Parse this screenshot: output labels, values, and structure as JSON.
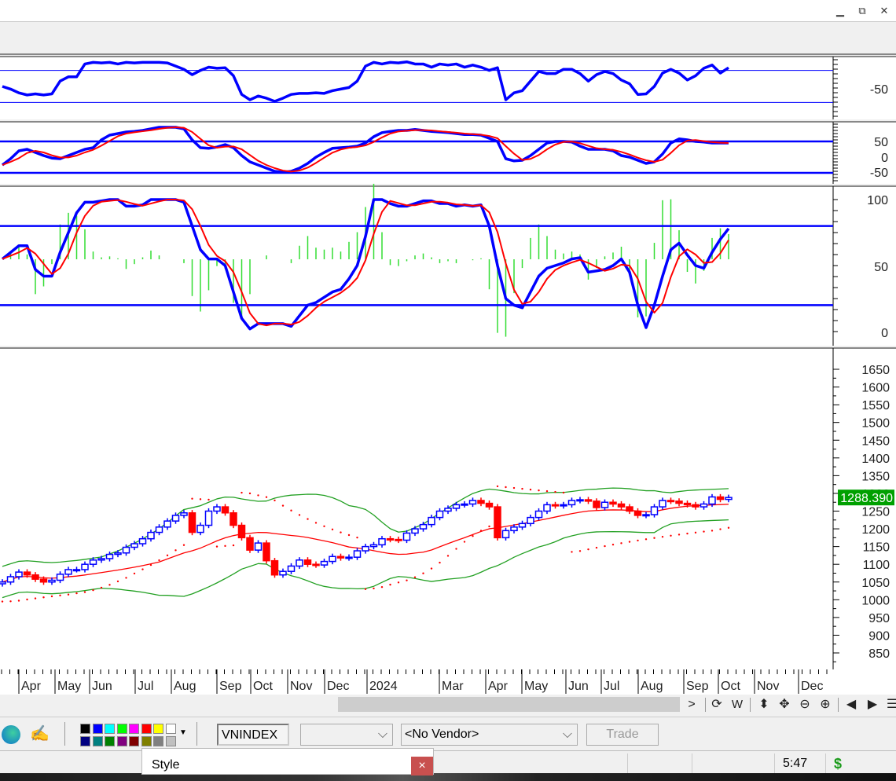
{
  "window": {
    "minimize_icon": "minimize-icon",
    "restore_icon": "restore-icon",
    "close_icon": "close-icon"
  },
  "chart_data": {
    "type": "candlestick",
    "symbol": "VNINDEX",
    "last_price_label": "1288.390",
    "x_tick_labels": [
      "Apr",
      "May",
      "Jun",
      "Jul",
      "Aug",
      "Sep",
      "Oct",
      "Nov",
      "Dec",
      "2024",
      "Mar",
      "Apr",
      "May",
      "Jun",
      "Jul",
      "Aug",
      "Sep",
      "Oct",
      "Nov",
      "Dec"
    ],
    "price_axis": {
      "ticks": [
        1650,
        1600,
        1550,
        1500,
        1450,
        1400,
        1350,
        1300,
        1250,
        1200,
        1150,
        1100,
        1050,
        1000,
        950,
        900,
        850
      ],
      "ylim": [
        830,
        1690
      ]
    },
    "close": [
      1050,
      1065,
      1078,
      1070,
      1058,
      1050,
      1055,
      1072,
      1085,
      1085,
      1100,
      1112,
      1116,
      1128,
      1132,
      1148,
      1158,
      1172,
      1190,
      1205,
      1222,
      1238,
      1245,
      1190,
      1210,
      1250,
      1262,
      1245,
      1210,
      1175,
      1140,
      1160,
      1110,
      1070,
      1080,
      1095,
      1112,
      1100,
      1098,
      1108,
      1122,
      1118,
      1120,
      1138,
      1150,
      1155,
      1172,
      1170,
      1168,
      1188,
      1200,
      1212,
      1232,
      1250,
      1258,
      1268,
      1270,
      1280,
      1272,
      1262,
      1175,
      1195,
      1205,
      1215,
      1232,
      1250,
      1268,
      1265,
      1268,
      1280,
      1282,
      1278,
      1260,
      1275,
      1270,
      1262,
      1250,
      1238,
      1240,
      1262,
      1280,
      1278,
      1272,
      1268,
      1262,
      1270,
      1290,
      1283,
      1288.39
    ],
    "williams_r": {
      "axis_label": "-50",
      "levels": [
        -20,
        -80
      ],
      "values": [
        -50,
        -55,
        -62,
        -66,
        -64,
        -66,
        -64,
        -40,
        -32,
        -32,
        -8,
        -5,
        -6,
        -5,
        -8,
        -5,
        -6,
        -5,
        -5,
        -5,
        -6,
        -12,
        -18,
        -28,
        -20,
        -14,
        -16,
        -15,
        -30,
        -65,
        -75,
        -68,
        -72,
        -78,
        -72,
        -65,
        -63,
        -63,
        -62,
        -63,
        -58,
        -55,
        -52,
        -40,
        -12,
        -5,
        -8,
        -5,
        -6,
        -4,
        -8,
        -8,
        -14,
        -8,
        -10,
        -8,
        -14,
        -10,
        -14,
        -20,
        -15,
        -75,
        -62,
        -58,
        -40,
        -22,
        -26,
        -26,
        -18,
        -18,
        -26,
        -40,
        -28,
        -22,
        -26,
        -38,
        -45,
        -65,
        -64,
        -50,
        -25,
        -18,
        -25,
        -38,
        -30,
        -16,
        -10,
        -25,
        -15
      ]
    },
    "cci": {
      "axis_labels": [
        "50",
        "0",
        "-50"
      ],
      "levels": [
        50,
        -50
      ],
      "values": [
        -25,
        -5,
        20,
        25,
        15,
        5,
        -3,
        -5,
        5,
        15,
        25,
        30,
        55,
        70,
        75,
        80,
        82,
        85,
        90,
        95,
        95,
        95,
        90,
        55,
        30,
        28,
        32,
        40,
        30,
        5,
        -15,
        -25,
        -35,
        -45,
        -48,
        -45,
        -35,
        -20,
        0,
        15,
        28,
        30,
        32,
        35,
        45,
        65,
        78,
        82,
        85,
        85,
        88,
        85,
        82,
        80,
        78,
        75,
        72,
        72,
        70,
        60,
        50,
        -5,
        -12,
        -10,
        5,
        25,
        45,
        50,
        50,
        48,
        35,
        25,
        25,
        25,
        20,
        5,
        0,
        -10,
        -20,
        -15,
        10,
        45,
        58,
        55,
        50,
        48,
        45,
        45,
        45
      ]
    },
    "stochastic": {
      "axis_labels": [
        "100",
        "50",
        "0"
      ],
      "levels": [
        80,
        20
      ],
      "k": [
        55,
        60,
        65,
        65,
        47,
        42,
        42,
        60,
        75,
        90,
        98,
        98,
        99,
        100,
        100,
        95,
        95,
        96,
        100,
        100,
        100,
        100,
        98,
        80,
        62,
        55,
        55,
        50,
        30,
        10,
        2,
        6,
        6,
        6,
        6,
        4,
        12,
        20,
        22,
        26,
        30,
        32,
        40,
        50,
        72,
        100,
        100,
        97,
        95,
        95,
        97,
        99,
        99,
        97,
        97,
        95,
        96,
        95,
        96,
        80,
        50,
        25,
        20,
        18,
        30,
        42,
        48,
        50,
        52,
        55,
        56,
        45,
        46,
        47,
        50,
        55,
        45,
        20,
        3,
        20,
        42,
        62,
        67,
        58,
        50,
        48,
        60,
        70,
        78
      ]
    },
    "colors": {
      "up": "#0000ff",
      "down": "#ff0000",
      "bands": "#22a022",
      "mid": "#ff0000",
      "signal": "#ff0000",
      "histogram": "#33dd33",
      "price_label_bg": "#00a000"
    }
  },
  "nav": {
    "next": ">",
    "icons": [
      "refresh-icon",
      "weekly-icon",
      "vertical-fit-icon",
      "pan-icon",
      "zoom-out-icon",
      "zoom-in-icon",
      "scroll-left-icon",
      "scroll-right-icon",
      "layout-icon"
    ],
    "weekly_label": "W"
  },
  "bottombar": {
    "symbol_value": "VNINDEX",
    "vendor_value": "<No Vendor>",
    "trade_label": "Trade",
    "palette": [
      "#000000",
      "#0000ff",
      "#00ffff",
      "#00ff00",
      "#ff00ff",
      "#ff0000",
      "#ffff00",
      "#ffffff",
      "#000080",
      "#008080",
      "#008000",
      "#800080",
      "#800000",
      "#808000",
      "#808080",
      "#c0c0c0"
    ]
  },
  "popup": {
    "title": "Style",
    "close": "×"
  },
  "status": {
    "time": "5:47",
    "currency": "$"
  }
}
